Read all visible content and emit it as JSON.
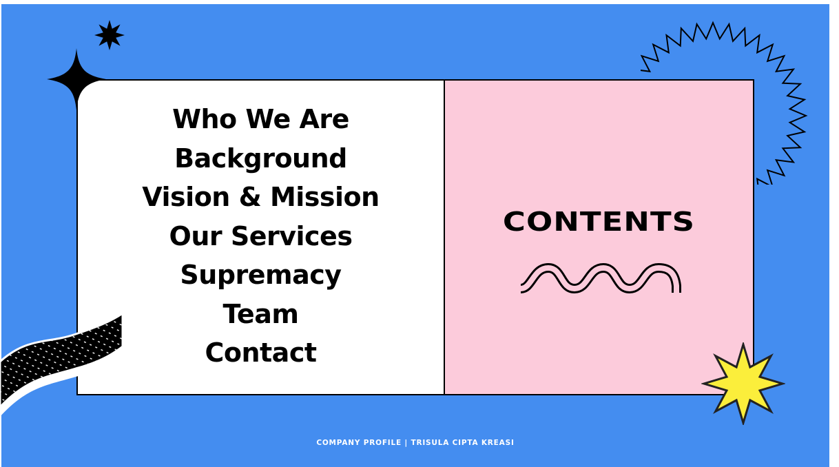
{
  "slide": {
    "menu_items": [
      "Who We Are",
      "Background",
      "Vision & Mission",
      "Our Services",
      "Supremacy",
      "Team",
      "Contact"
    ],
    "heading": "CONTENTS",
    "footer": "COMPANY PROFILE | TRISULA CIPTA KREASI"
  },
  "colors": {
    "background_blue": "#448df0",
    "panel_pink": "#fccbdb",
    "star_yellow": "#fbee3b",
    "ink": "#000000"
  },
  "icons": [
    "small-black-starburst-icon",
    "four-point-star-icon",
    "zigzag-sunburst-icon",
    "dotted-wave-ribbon-icon",
    "yellow-star-icon",
    "squiggle-line-icon"
  ]
}
